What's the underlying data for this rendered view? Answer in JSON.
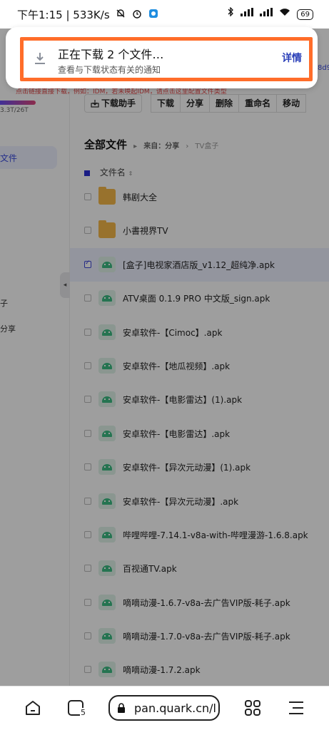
{
  "status_bar": {
    "time": "下午1:15",
    "speed": "533K/s",
    "battery": "69"
  },
  "notification": {
    "title": "正在下载 2 个文件…",
    "subtitle": "查看与下载状态有关的通知",
    "action": "详情",
    "highlight_color": "#ff6d2a"
  },
  "page": {
    "hint": "点击链接直接下载，例如：IDM，若未唤起IDM，请点击这里配置文件类型",
    "top_link": "8d9",
    "sidebar": {
      "quota": "3.3T/26T",
      "active_item": "文件",
      "items": [
        "子",
        "分享"
      ]
    },
    "toolbar": {
      "helper": "下载助手",
      "buttons": [
        "下载",
        "分享",
        "删除",
        "重命名",
        "移动"
      ]
    },
    "breadcrumb": {
      "title": "全部文件",
      "from_label": "来自：分享",
      "path": "TV盒子"
    },
    "list_header": "文件名",
    "files": [
      {
        "name": "韩剧大全",
        "type": "folder",
        "checked": false
      },
      {
        "name": "小書視界TV",
        "type": "folder",
        "checked": false
      },
      {
        "name": "[盒子]电视家酒店版_v1.12_超纯净.apk",
        "type": "apk",
        "checked": true
      },
      {
        "name": "ATV桌面 0.1.9 PRO 中文版_sign.apk",
        "type": "apk",
        "checked": false
      },
      {
        "name": "安卓软件-【Cimoc】.apk",
        "type": "apk",
        "checked": false
      },
      {
        "name": "安卓软件-【地瓜视频】.apk",
        "type": "apk",
        "checked": false
      },
      {
        "name": "安卓软件-【电影雷达】(1).apk",
        "type": "apk",
        "checked": false
      },
      {
        "name": "安卓软件-【电影雷达】.apk",
        "type": "apk",
        "checked": false
      },
      {
        "name": "安卓软件-【异次元动漫】(1).apk",
        "type": "apk",
        "checked": false
      },
      {
        "name": "安卓软件-【异次元动漫】.apk",
        "type": "apk",
        "checked": false
      },
      {
        "name": "哔哩哔哩-7.14.1-v8a-with-哔哩漫游-1.6.8.apk",
        "type": "apk",
        "checked": false
      },
      {
        "name": "百视通TV.apk",
        "type": "apk",
        "checked": false
      },
      {
        "name": "嘀嘀动漫-1.6.7-v8a-去广告VIP版-耗子.apk",
        "type": "apk",
        "checked": false
      },
      {
        "name": "嘀嘀动漫-1.7.0-v8a-去广告VIP版-耗子.apk",
        "type": "apk",
        "checked": false
      },
      {
        "name": "嘀嘀动漫-1.7.2.apk",
        "type": "apk",
        "checked": false
      }
    ]
  },
  "bottom_bar": {
    "url": "pan.quark.cn/l",
    "tab_count": "5"
  }
}
